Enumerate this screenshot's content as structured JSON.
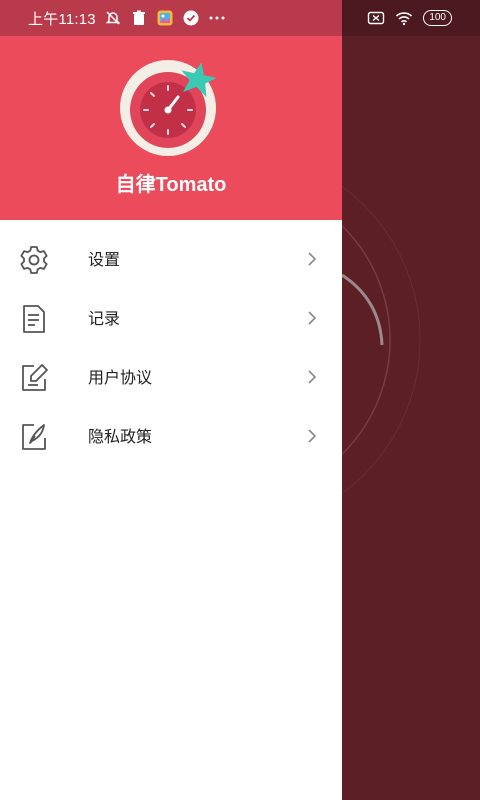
{
  "status_bar": {
    "time": "上午11:13",
    "battery": "100",
    "icons": [
      "bell-off-icon",
      "trash-icon",
      "gallery-icon",
      "check-circle-icon",
      "more-icon",
      "sim-x-icon",
      "wifi-icon",
      "battery-icon"
    ]
  },
  "drawer": {
    "app_name": "自律Tomato",
    "logo": "tomato-timer-logo",
    "menu": [
      {
        "label": "设置",
        "icon": "gear-icon"
      },
      {
        "label": "记录",
        "icon": "document-icon"
      },
      {
        "label": "用户协议",
        "icon": "edit-document-icon"
      },
      {
        "label": "隐私政策",
        "icon": "pen-document-icon"
      }
    ]
  },
  "colors": {
    "header": "#ec4b5c",
    "status_bar": "#b83a4b",
    "scrim": "#5c1f26",
    "accent_star": "#3cc9b4"
  }
}
